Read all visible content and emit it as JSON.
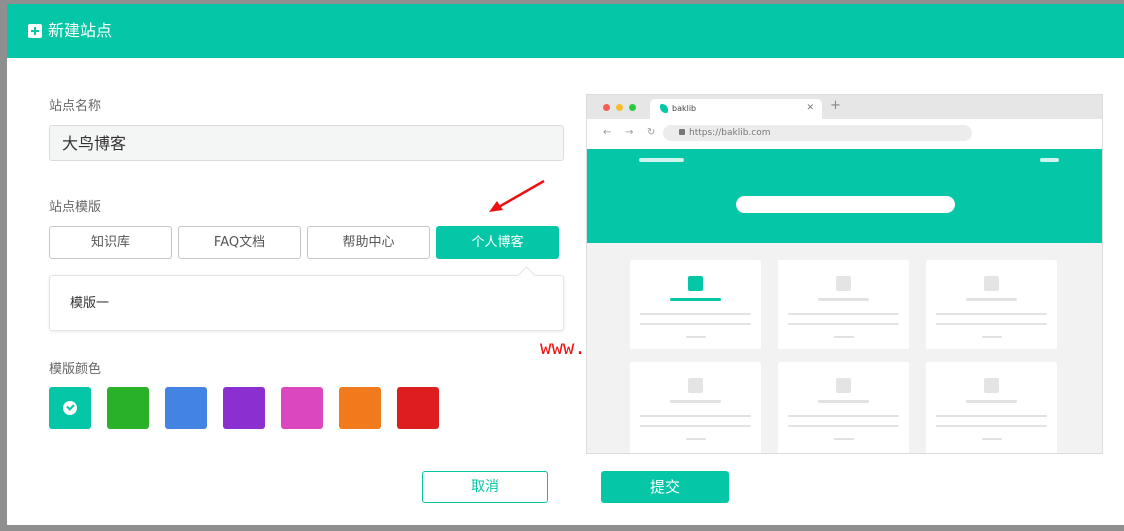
{
  "dialog": {
    "title": "新建站点"
  },
  "form": {
    "site_name_label": "站点名称",
    "site_name_value": "大鸟博客",
    "template_label": "站点模版",
    "templates": [
      {
        "label": "知识库",
        "active": false
      },
      {
        "label": "FAQ文档",
        "active": false
      },
      {
        "label": "帮助中心",
        "active": false
      },
      {
        "label": "个人博客",
        "active": true
      }
    ],
    "template_variant": "模版一",
    "color_label": "模版颜色",
    "colors": [
      "#05c6a6",
      "#29b12a",
      "#4383e2",
      "#8b2fd1",
      "#db47bf",
      "#f17a1c",
      "#de1e1e"
    ],
    "selected_color_index": 0
  },
  "watermark": "www.daniao.org",
  "preview": {
    "tab_title": "baklib",
    "url": "https://baklib.com",
    "accent": "#05c6a6"
  },
  "footer": {
    "cancel_label": "取消",
    "submit_label": "提交"
  }
}
